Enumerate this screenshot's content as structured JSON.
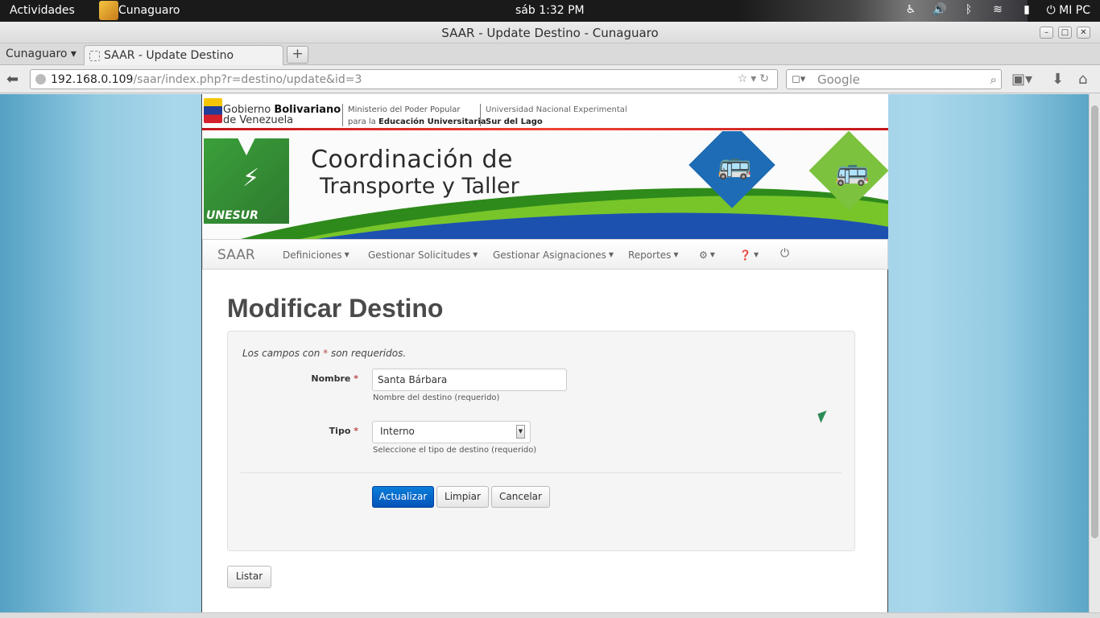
{
  "desktop": {
    "activities": "Actividades",
    "app_name": "Cunaguaro",
    "clock": "sáb  1:32 PM",
    "user": "MI PC",
    "tray_icons": [
      "accessibility-icon",
      "volume-icon",
      "bluetooth-icon",
      "wifi-icon",
      "battery-icon",
      "power-icon"
    ]
  },
  "window": {
    "title": "SAAR - Update Destino - Cunaguaro",
    "minimize": "–",
    "maximize": "□",
    "close": "✕"
  },
  "browser": {
    "tab_groups": "Cunaguaro ▾",
    "tab_label": "SAAR - Update Destino",
    "new_tab": "+",
    "url_host": "192.168.0.109",
    "url_path": "/saar/index.php?r=destino/update&id=3",
    "search_placeholder": "Google"
  },
  "header": {
    "gov_line1_normal": "Gobierno ",
    "gov_line1_bold": "Bolivariano",
    "gov_line2": "de Venezuela",
    "ministry_line1": "Ministerio del Poder Popular",
    "ministry_line2_normal": "para la ",
    "ministry_line2_bold": "Educación Universitaria",
    "univ_line1": "Universidad Nacional Experimental",
    "univ_line2": "Sur del Lago",
    "banner_line1": "Coordinación de",
    "banner_line2": "Transporte y Taller",
    "logo_text": "UNESUR"
  },
  "nav": {
    "brand": "SAAR",
    "items": [
      "Definiciones",
      "Gestionar Solicitudes",
      "Gestionar Asignaciones",
      "Reportes"
    ]
  },
  "page": {
    "title": "Modificar Destino",
    "required_note_pre": "Los campos con ",
    "required_note_star": "*",
    "required_note_post": " son requeridos.",
    "fields": {
      "nombre": {
        "label": "Nombre",
        "value": "Santa Bárbara",
        "help": "Nombre del destino (requerido)"
      },
      "tipo": {
        "label": "Tipo",
        "value": "Interno",
        "help": "Seleccione el tipo de destino (requerido)"
      }
    },
    "buttons": {
      "update": "Actualizar",
      "clear": "Limpiar",
      "cancel": "Cancelar",
      "list": "Listar"
    }
  },
  "colors": {
    "primary_button": "#0553b9",
    "required": "#b94a48",
    "background": "#9acfe4"
  }
}
